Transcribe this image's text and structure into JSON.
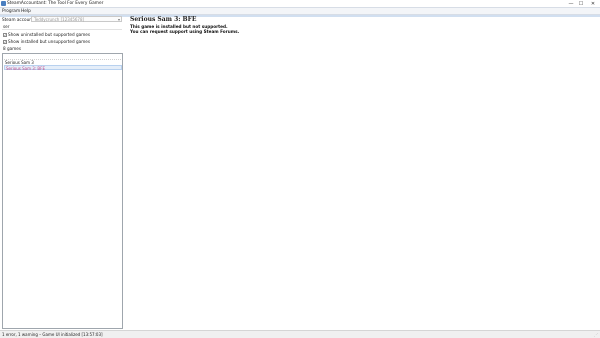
{
  "window": {
    "title": "SteamAccountant: The Tool For Every Gamer",
    "minimize_glyph": "—",
    "maximize_glyph": "☐",
    "close_glyph": "✕"
  },
  "menu": {
    "items": [
      "Program",
      "Help"
    ]
  },
  "account": {
    "label": "Steam account:",
    "value": "Teddycrunch [12345678]"
  },
  "search": {
    "value": "ser",
    "placeholder": ""
  },
  "filters": {
    "show_uninstalled": {
      "label": "Show uninstalled but supported games",
      "checked": true
    },
    "show_unsupported": {
      "label": "Show installed but unsupported games",
      "checked": true
    }
  },
  "games": {
    "count_label": "8 games",
    "items": [
      {
        "name": "Serious Sam 3",
        "selected": false
      },
      {
        "name": "Serious Sam 3: BFE",
        "selected": true
      }
    ]
  },
  "detail": {
    "title": "Serious Sam 3: BFE",
    "line1": "This game is installed but not supported.",
    "line2": "You can request support using Steam Forums."
  },
  "status": {
    "text": "1 error, 1 warning – Game UI initialized [13:57:03]"
  },
  "icons": {
    "app": "app-icon",
    "checkbox_checked": "✓",
    "dropdown": "▾",
    "grip": "⋰"
  },
  "colors": {
    "selected_text": "#c04b8a",
    "selected_bg": "#e5eef9",
    "accent_line": "#d1dff0"
  }
}
